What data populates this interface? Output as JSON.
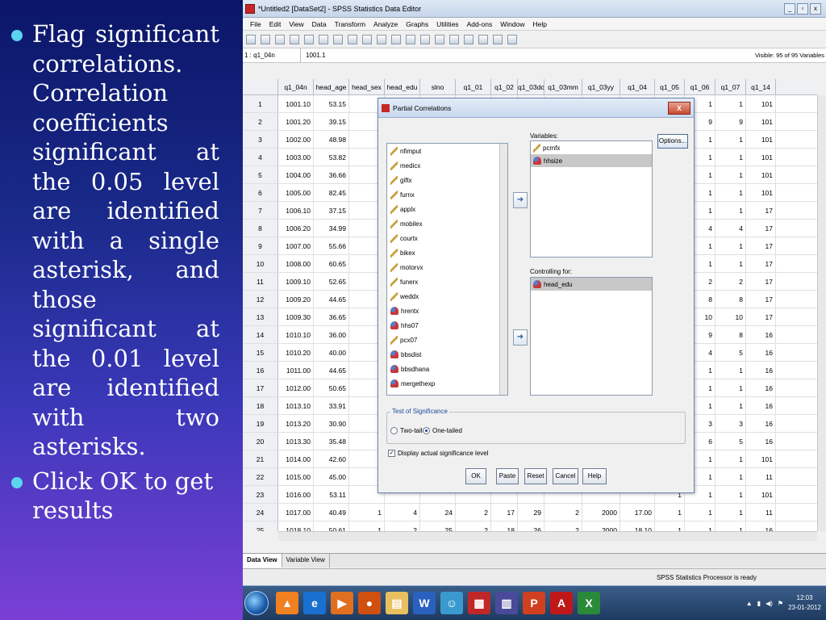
{
  "slide": {
    "bullets": [
      "Flag significant correlations. Correlation coefficients significant at the 0.05 level are identified with a single asterisk, and those significant at the 0.01 level are identified with two asterisks.",
      "Click OK to get results"
    ],
    "bullet_color": "#5ad6f0"
  },
  "window": {
    "title": "*Untitled2 [DataSet2] - SPSS Statistics Data Editor",
    "menus": [
      "File",
      "Edit",
      "View",
      "Data",
      "Transform",
      "Analyze",
      "Graphs",
      "Utilities",
      "Add-ons",
      "Window",
      "Help"
    ],
    "cell_ref": "1 : q1_04n",
    "cell_value": "1001.1",
    "visible_text": "Visible: 95 of 95 Variables",
    "columns": [
      "q1_04n",
      "head_age",
      "head_sex",
      "head_edu",
      "slno",
      "q1_01",
      "q1_02",
      "q1_03dd",
      "q1_03mm",
      "q1_03yy",
      "q1_04",
      "q1_05",
      "q1_06",
      "q1_07",
      "q1_14"
    ],
    "rows": [
      [
        "1",
        "1001.10",
        "53.15",
        "",
        "",
        "",
        "",
        "",
        "",
        "",
        "",
        "",
        "1",
        "1",
        "1",
        "101"
      ],
      [
        "2",
        "1001.20",
        "39.15",
        "",
        "",
        "",
        "",
        "",
        "",
        "",
        "",
        "",
        "1",
        "9",
        "9",
        "101"
      ],
      [
        "3",
        "1002.00",
        "48.98",
        "",
        "",
        "",
        "",
        "",
        "",
        "",
        "",
        "",
        "1",
        "1",
        "1",
        "101"
      ],
      [
        "4",
        "1003.00",
        "53.82",
        "",
        "",
        "",
        "",
        "",
        "",
        "",
        "",
        "",
        "1",
        "1",
        "1",
        "101"
      ],
      [
        "5",
        "1004.00",
        "36.66",
        "",
        "",
        "",
        "",
        "",
        "",
        "",
        "",
        "",
        "1",
        "1",
        "1",
        "101"
      ],
      [
        "6",
        "1005.00",
        "82.45",
        "",
        "",
        "",
        "",
        "",
        "",
        "",
        "",
        "",
        "1",
        "1",
        "1",
        "101"
      ],
      [
        "7",
        "1006.10",
        "37.15",
        "",
        "",
        "",
        "",
        "",
        "",
        "",
        "",
        "",
        "1",
        "1",
        "1",
        "17"
      ],
      [
        "8",
        "1006.20",
        "34.99",
        "",
        "",
        "",
        "",
        "",
        "",
        "",
        "",
        "",
        "2",
        "4",
        "4",
        "17"
      ],
      [
        "9",
        "1007.00",
        "55.66",
        "",
        "",
        "",
        "",
        "",
        "",
        "",
        "",
        "",
        "1",
        "1",
        "1",
        "17"
      ],
      [
        "10",
        "1008.00",
        "60.65",
        "",
        "",
        "",
        "",
        "",
        "",
        "",
        "",
        "",
        "1",
        "1",
        "1",
        "17"
      ],
      [
        "11",
        "1009.10",
        "52.65",
        "",
        "",
        "",
        "",
        "",
        "",
        "",
        "",
        "",
        "1",
        "2",
        "2",
        "17"
      ],
      [
        "12",
        "1009.20",
        "44.65",
        "",
        "",
        "",
        "",
        "",
        "",
        "",
        "",
        "",
        "1",
        "8",
        "8",
        "17"
      ],
      [
        "13",
        "1009.30",
        "36.65",
        "",
        "",
        "",
        "",
        "",
        "",
        "",
        "",
        "",
        "1",
        "10",
        "10",
        "17"
      ],
      [
        "14",
        "1010.10",
        "36.00",
        "",
        "",
        "",
        "",
        "",
        "",
        "",
        "",
        "",
        "1",
        "9",
        "8",
        "16"
      ],
      [
        "15",
        "1010.20",
        "40.00",
        "",
        "",
        "",
        "",
        "",
        "",
        "",
        "",
        "",
        "1",
        "4",
        "5",
        "16"
      ],
      [
        "16",
        "1011.00",
        "44.65",
        "",
        "",
        "",
        "",
        "",
        "",
        "",
        "",
        "",
        "1",
        "1",
        "1",
        "16"
      ],
      [
        "17",
        "1012.00",
        "50.65",
        "",
        "",
        "",
        "",
        "",
        "",
        "",
        "",
        "",
        "1",
        "1",
        "1",
        "16"
      ],
      [
        "18",
        "1013.10",
        "33.91",
        "",
        "",
        "",
        "",
        "",
        "",
        "",
        "",
        "",
        "1",
        "1",
        "1",
        "16"
      ],
      [
        "19",
        "1013.20",
        "30.90",
        "",
        "",
        "",
        "",
        "",
        "",
        "",
        "",
        "",
        "1",
        "3",
        "3",
        "16"
      ],
      [
        "20",
        "1013.30",
        "35.48",
        "",
        "",
        "",
        "",
        "",
        "",
        "",
        "",
        "",
        "1",
        "6",
        "5",
        "16"
      ],
      [
        "21",
        "1014.00",
        "42.60",
        "",
        "",
        "",
        "",
        "",
        "",
        "",
        "",
        "",
        "1",
        "1",
        "1",
        "101"
      ],
      [
        "22",
        "1015.00",
        "45.00",
        "",
        "",
        "",
        "",
        "",
        "",
        "",
        "",
        "",
        "1",
        "1",
        "1",
        "11"
      ],
      [
        "23",
        "1016.00",
        "53.11",
        "",
        "",
        "",
        "",
        "",
        "",
        "",
        "",
        "",
        "1",
        "1",
        "1",
        "101"
      ],
      [
        "24",
        "1017.00",
        "40.49",
        "1",
        "4",
        "24",
        "2",
        "17",
        "29",
        "2",
        "2000",
        "17.00",
        "1",
        "1",
        "1",
        "11"
      ],
      [
        "25",
        "1018.10",
        "50.61",
        "1",
        "2",
        "25",
        "2",
        "18",
        "26",
        "2",
        "2000",
        "18.10",
        "1",
        "1",
        "1",
        "16"
      ]
    ],
    "tabs": [
      "Data View",
      "Variable View"
    ],
    "status": "SPSS Statistics  Processor is ready"
  },
  "dialog": {
    "title": "Partial Correlations",
    "source_vars": [
      {
        "name": "nfimput",
        "type": "scale"
      },
      {
        "name": "medicx",
        "type": "scale"
      },
      {
        "name": "giftx",
        "type": "scale"
      },
      {
        "name": "furnx",
        "type": "scale"
      },
      {
        "name": "applx",
        "type": "scale"
      },
      {
        "name": "mobilex",
        "type": "scale"
      },
      {
        "name": "courtx",
        "type": "scale"
      },
      {
        "name": "bikex",
        "type": "scale"
      },
      {
        "name": "motorvx",
        "type": "scale"
      },
      {
        "name": "funerx",
        "type": "scale"
      },
      {
        "name": "weddx",
        "type": "scale"
      },
      {
        "name": "hrentx",
        "type": "nominal"
      },
      {
        "name": "hhs07",
        "type": "nominal"
      },
      {
        "name": "pcx07",
        "type": "scale"
      },
      {
        "name": "bbsdist",
        "type": "nominal"
      },
      {
        "name": "bbsdhana",
        "type": "nominal"
      },
      {
        "name": "mergethexp",
        "type": "nominal"
      }
    ],
    "variables_label": "Variables:",
    "variables": [
      {
        "name": "pcmfx",
        "type": "scale",
        "selected": false
      },
      {
        "name": "hhsize",
        "type": "nominal",
        "selected": true
      }
    ],
    "controlling_label": "Controlling for:",
    "controlling": [
      {
        "name": "head_edu",
        "type": "nominal",
        "selected": true
      }
    ],
    "options_label": "Options...",
    "sig_legend": "Test of Significance",
    "two_tailed": "Two-tailed",
    "one_tailed": "One-tailed",
    "display_sig": "Display actual significance level",
    "buttons": [
      "OK",
      "Paste",
      "Reset",
      "Cancel",
      "Help"
    ]
  },
  "taskbar": {
    "time": "12:03",
    "date": "23-01-2012"
  }
}
